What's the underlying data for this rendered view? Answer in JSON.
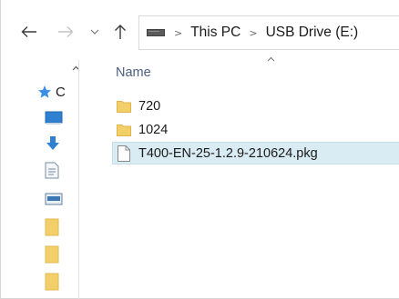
{
  "navigation": {
    "back_icon": "arrow-left-icon",
    "forward_icon": "arrow-right-icon",
    "recent_icon": "chevron-down-icon",
    "up_icon": "arrow-up-icon"
  },
  "address_bar": {
    "location_icon": "drive-icon",
    "breadcrumbs": [
      "This PC",
      "USB Drive (E:)"
    ],
    "separator": ">"
  },
  "nav_pane": {
    "quick_access_label_visible": "C",
    "items": [
      {
        "icon": "star-icon",
        "color": "#3a8ee6"
      },
      {
        "icon": "desktop-icon",
        "color": "#2f80d0"
      },
      {
        "icon": "download-icon",
        "color": "#2f80d0"
      },
      {
        "icon": "document-icon",
        "color": "#6f8fae"
      },
      {
        "icon": "pictures-icon",
        "color": "#3c78b4"
      },
      {
        "icon": "folder-icon",
        "color": "#f3cf6a"
      },
      {
        "icon": "folder-icon",
        "color": "#f3cf6a"
      },
      {
        "icon": "folder-icon",
        "color": "#f3cf6a"
      }
    ]
  },
  "content": {
    "column_header": "Name",
    "files": [
      {
        "name": "720",
        "type": "folder",
        "selected": false
      },
      {
        "name": "1024",
        "type": "folder",
        "selected": false
      },
      {
        "name": "T400-EN-25-1.2.9-210624.pkg",
        "type": "file",
        "selected": true
      }
    ]
  },
  "colors": {
    "folder": "#f3cf6a",
    "selection_bg": "#d9ebf3",
    "header_text": "#4d6082"
  }
}
